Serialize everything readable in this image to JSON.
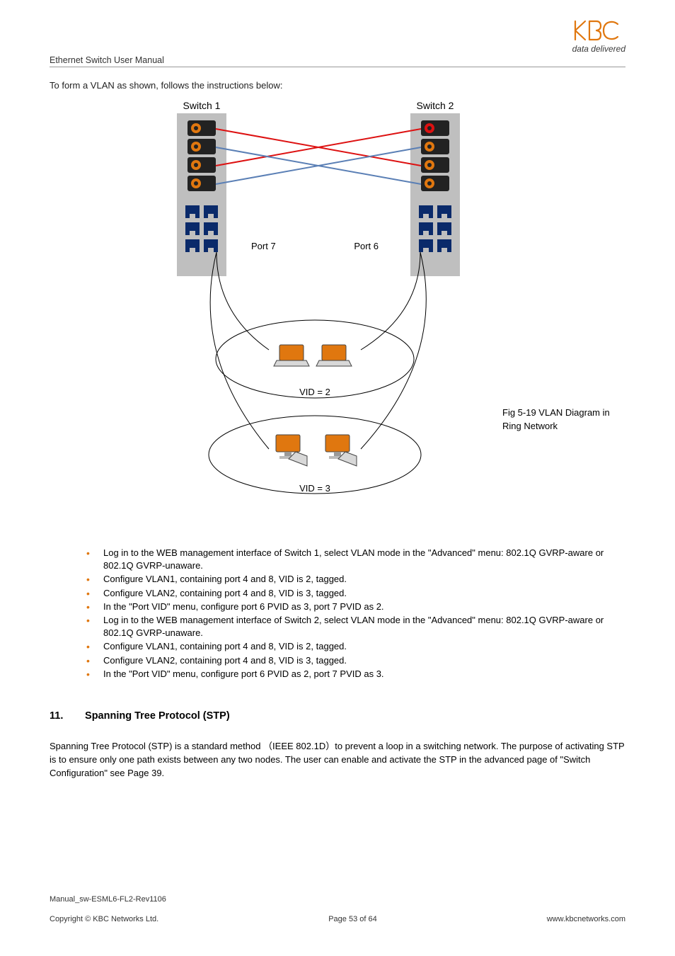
{
  "header": {
    "doc_title": "Ethernet Switch User Manual",
    "logo_subtitle": "data delivered"
  },
  "intro": "To form a VLAN as shown, follows the instructions below:",
  "diagram": {
    "switch1_label": "Switch 1",
    "switch2_label": "Switch 2",
    "port7_label": "Port 7",
    "port6_label": "Port 6",
    "vid2_label": "VID = 2",
    "vid3_label": "VID = 3",
    "caption_line1": "Fig 5-19 VLAN Diagram in",
    "caption_line2": "Ring Network"
  },
  "steps": [
    "Log in to the WEB management interface of Switch 1, select VLAN mode in the \"Advanced\" menu: 802.1Q GVRP-aware or 802.1Q GVRP-unaware.",
    "Configure VLAN1, containing port 4 and 8, VID is 2, tagged.",
    "Configure VLAN2, containing port 4 and 8, VID is 3, tagged.",
    "In the \"Port VID\" menu, configure port 6 PVID as 3, port 7 PVID as 2.",
    "Log in to the WEB management interface of Switch 2, select VLAN mode in the \"Advanced\" menu: 802.1Q GVRP-aware or 802.1Q GVRP-unaware.",
    "Configure VLAN1, containing port 4 and 8, VID is 2, tagged.",
    "Configure VLAN2, containing port 4 and 8, VID is 3, tagged.",
    "In the \"Port VID\" menu, configure port 6 PVID as 2, port 7 PVID as 3."
  ],
  "section": {
    "number": "11.",
    "title": "Spanning Tree Protocol (STP)",
    "body": "Spanning Tree Protocol (STP) is a standard method （IEEE 802.1D）to prevent a loop in a switching network. The purpose of activating STP is to ensure only one path exists between any two nodes. The user can enable and activate the STP in the advanced page of \"Switch Configuration\" see Page 39."
  },
  "footer": {
    "rev": "Manual_sw-ESML6-FL2-Rev1106",
    "copyright": "Copyright © KBC Networks Ltd.",
    "page": "Page 53 of 64",
    "url": "www.kbcnetworks.com"
  }
}
